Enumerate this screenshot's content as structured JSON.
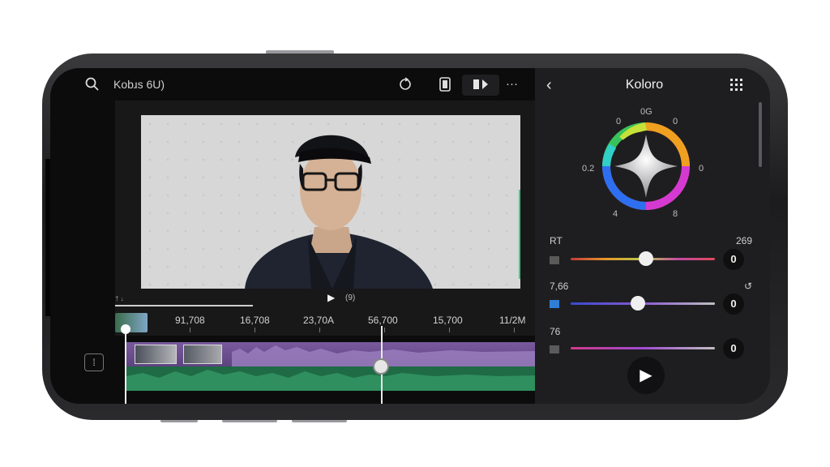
{
  "topbar": {
    "title": "Kobɹs 6U)",
    "more_label": "···"
  },
  "preview": {
    "time": "(9)",
    "marker": "† ↓"
  },
  "timeline": {
    "ticks": [
      "91,708",
      "16,708",
      "23,70A",
      "56,700",
      "15,700",
      "11/2M"
    ]
  },
  "panel": {
    "title": "Koloro",
    "wheel_labels": {
      "top": "0G",
      "top_right": "0",
      "right": "0",
      "left": "0.2",
      "bottom_left": "4",
      "bottom_right": "8",
      "top_left": "0"
    },
    "rows": [
      {
        "label": "RT",
        "top_value": "269",
        "value": "0",
        "swatch_color": "#5a5a5a",
        "level": 0.52
      },
      {
        "label": "7,66",
        "top_value": "↺",
        "value": "0",
        "swatch_color": "#2f7fd6",
        "level": 0.46
      },
      {
        "label": "76",
        "top_value": "",
        "value": "0",
        "swatch_color": "#5a5a5a",
        "level": null
      }
    ]
  }
}
